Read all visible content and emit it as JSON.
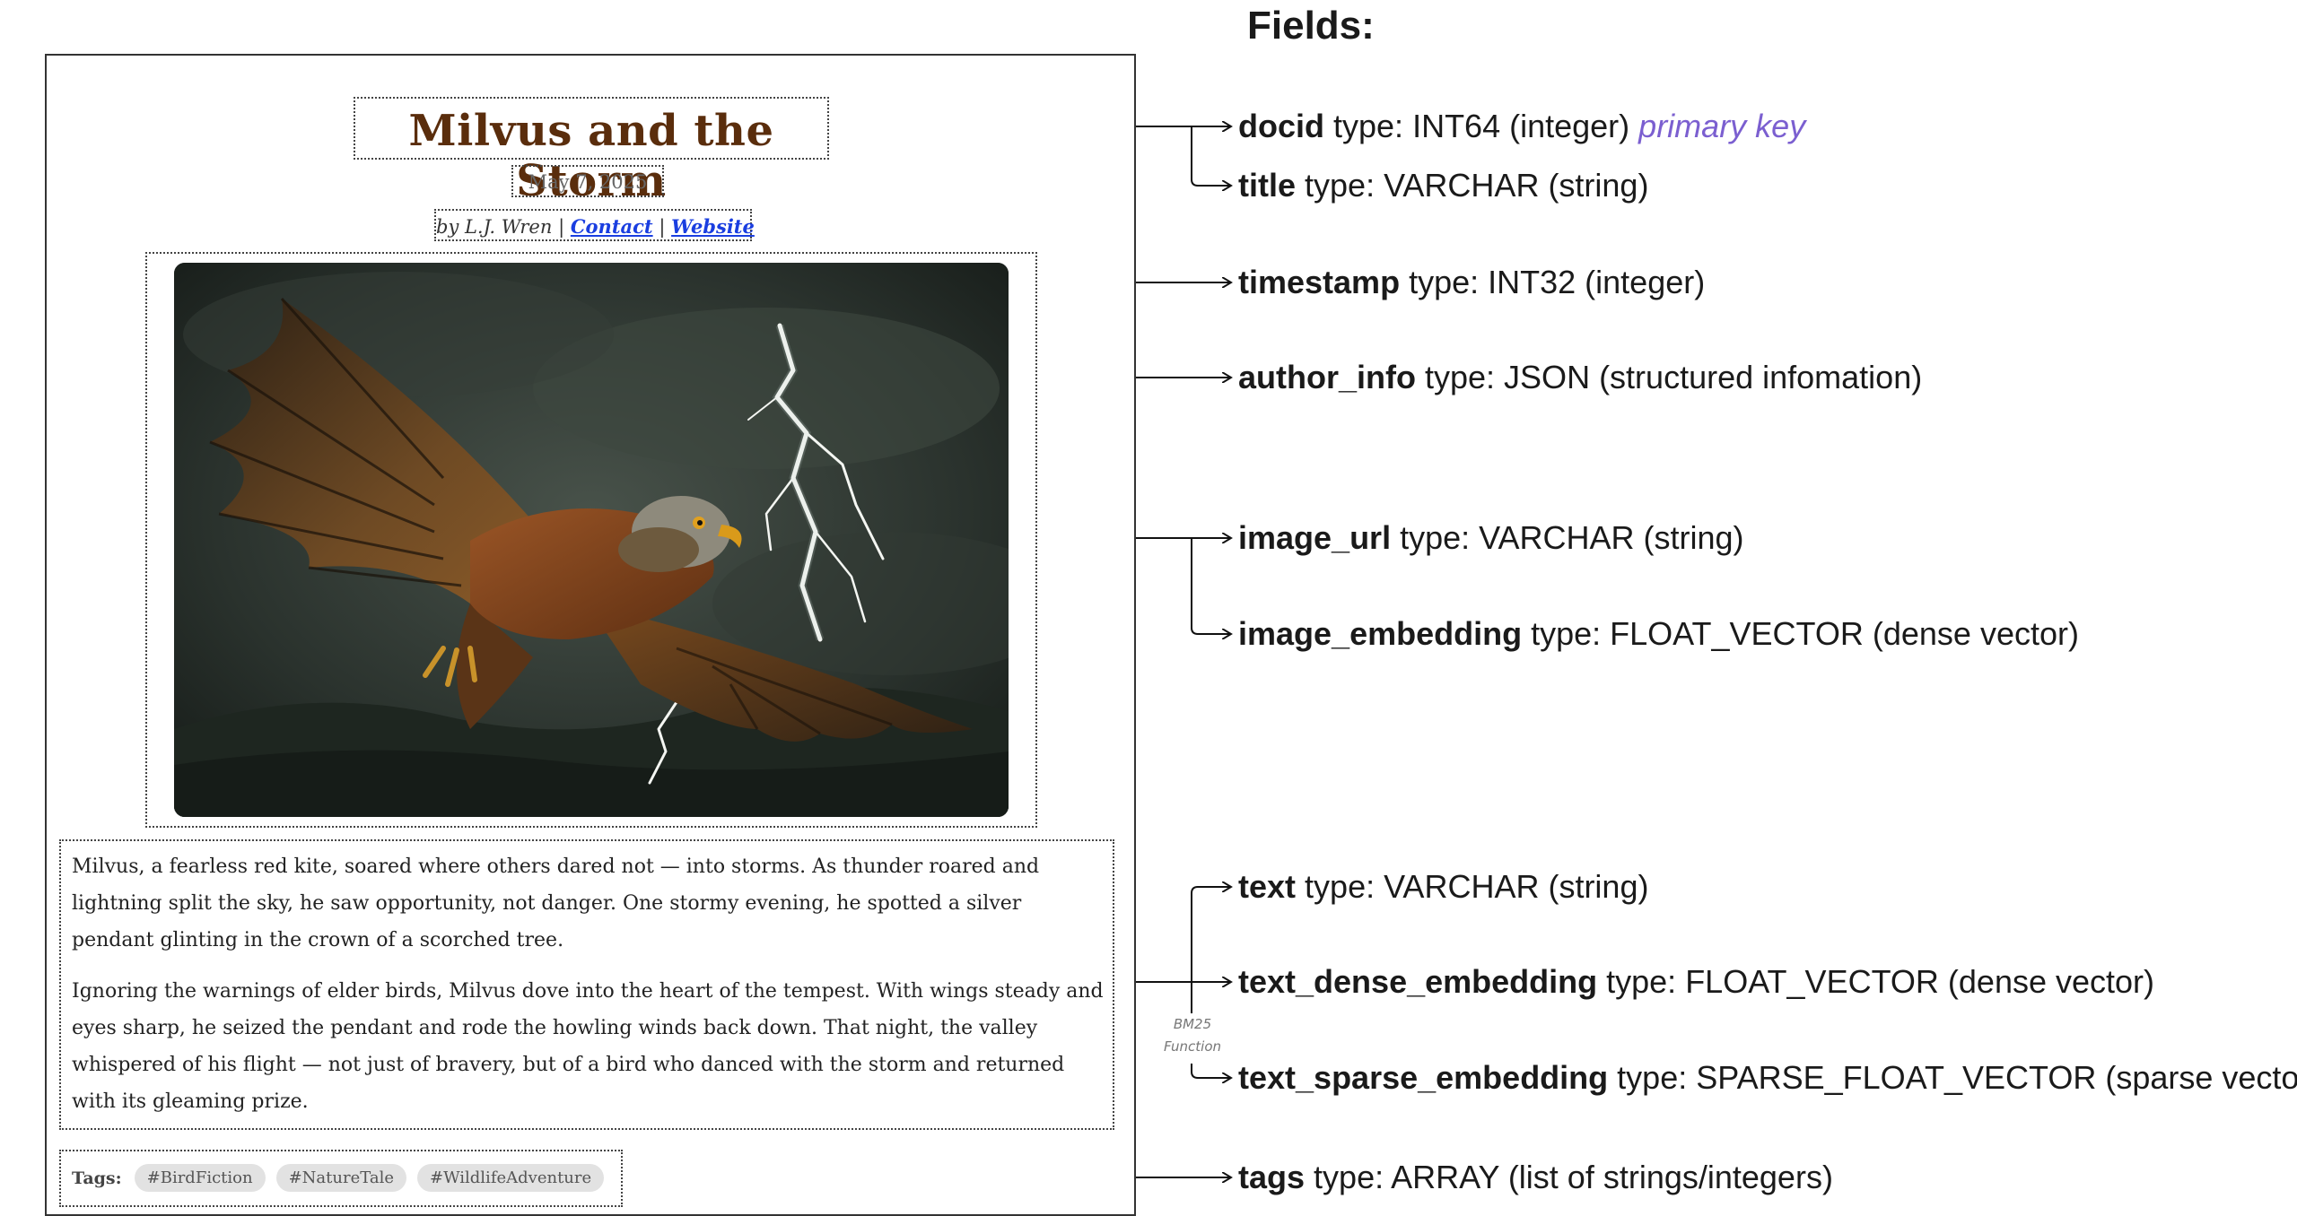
{
  "fields_title": "Fields:",
  "document": {
    "title": "Milvus and the Storm",
    "date": "May 7, 2025",
    "byline_prefix": "by L.J. Wren",
    "separator": "|",
    "contact_link": "Contact",
    "website_link": "Website",
    "image_subject": "red kite flying through a thunderstorm with lightning",
    "paragraphs": [
      "Milvus, a fearless red kite, soared where others dared not — into storms. As thunder roared and lightning split the sky, he saw opportunity, not danger. One stormy evening, he spotted a silver pendant glinting in the crown of a scorched tree.",
      "Ignoring the warnings of elder birds, Milvus dove into the heart of the tempest. With wings steady and eyes sharp, he seized the pendant and rode the howling winds back down. That night, the valley whispered of his flight — not just of bravery, but of a bird who danced with the storm and returned with its gleaming prize."
    ],
    "tags_label": "Tags:",
    "tags": [
      "#BirdFiction",
      "#NatureTale",
      "#WildlifeAdventure"
    ]
  },
  "fields": [
    {
      "name": "docid",
      "type": "type: INT64 (integer)",
      "note": "primary key"
    },
    {
      "name": "title",
      "type": "type: VARCHAR (string)"
    },
    {
      "name": "timestamp",
      "type": "type: INT32 (integer)"
    },
    {
      "name": "author_info",
      "type": "type: JSON (structured infomation)"
    },
    {
      "name": "image_url",
      "type": "type: VARCHAR (string)"
    },
    {
      "name": "image_embedding",
      "type": "type: FLOAT_VECTOR (dense vector)"
    },
    {
      "name": "text",
      "type": "type: VARCHAR (string)"
    },
    {
      "name": "text_dense_embedding",
      "type": "type: FLOAT_VECTOR (dense vector)"
    },
    {
      "name": "text_sparse_embedding",
      "type": "type: SPARSE_FLOAT_VECTOR (sparse vector)"
    },
    {
      "name": "tags",
      "type": "type: ARRAY (list of strings/integers)"
    }
  ],
  "bm25_label_line1": "BM25",
  "bm25_label_line2": "Function",
  "colors": {
    "title_brown": "#5a2d0c",
    "link_blue": "#1a3ee0",
    "primary_key_purple": "#7b5fd0",
    "tag_pill_gray": "#e2e2e2"
  }
}
